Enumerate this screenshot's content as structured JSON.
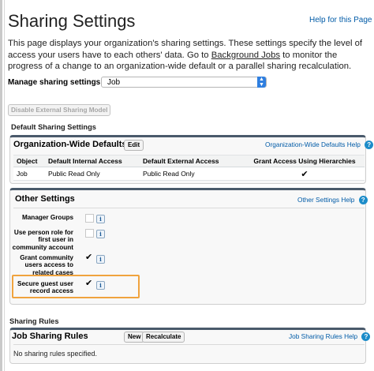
{
  "header": {
    "title": "Sharing Settings",
    "help_link": "Help for this Page",
    "help_icon": "?"
  },
  "intro": {
    "text_before": "This page displays your organization's sharing settings. These settings specify the level of access your users have to each others' data. Go to ",
    "link": "Background Jobs",
    "text_after": " to monitor the progress of a change to an organization-wide default or a parallel sharing recalculation."
  },
  "manage": {
    "label": "Manage sharing settings for:",
    "selected": "Job"
  },
  "disable_button": "Disable External Sharing Model",
  "default_section": {
    "label": "Default Sharing Settings",
    "title": "Organization-Wide Defaults",
    "edit_button": "Edit",
    "help_link": "Organization-Wide Defaults Help",
    "columns": [
      "Object",
      "Default Internal Access",
      "Default External Access",
      "Grant Access Using Hierarchies"
    ],
    "rows": [
      {
        "object": "Job",
        "internal": "Public Read Only",
        "external": "Public Read Only",
        "hierarchies": "✔"
      }
    ]
  },
  "other_settings": {
    "title": "Other Settings",
    "help_link": "Other Settings Help",
    "items": [
      {
        "label": "Manager Groups",
        "checked": false
      },
      {
        "label": "Use person role for first user in community account",
        "checked": false
      },
      {
        "label": "Grant community users access to related cases",
        "checked": true
      },
      {
        "label": "Secure guest user record access",
        "checked": true
      }
    ],
    "check_glyph": "✔",
    "info_glyph": "i"
  },
  "sharing_rules": {
    "label": "Sharing Rules",
    "title": "Job Sharing Rules",
    "new_button": "New",
    "recalc_button": "Recalculate",
    "help_link": "Job Sharing Rules Help",
    "empty_text": "No sharing rules specified."
  },
  "colors": {
    "link": "#015ba7",
    "block_top": "#4a5a6b",
    "highlight": "#f0a33e",
    "select_arrow": "#2f7fe0"
  }
}
